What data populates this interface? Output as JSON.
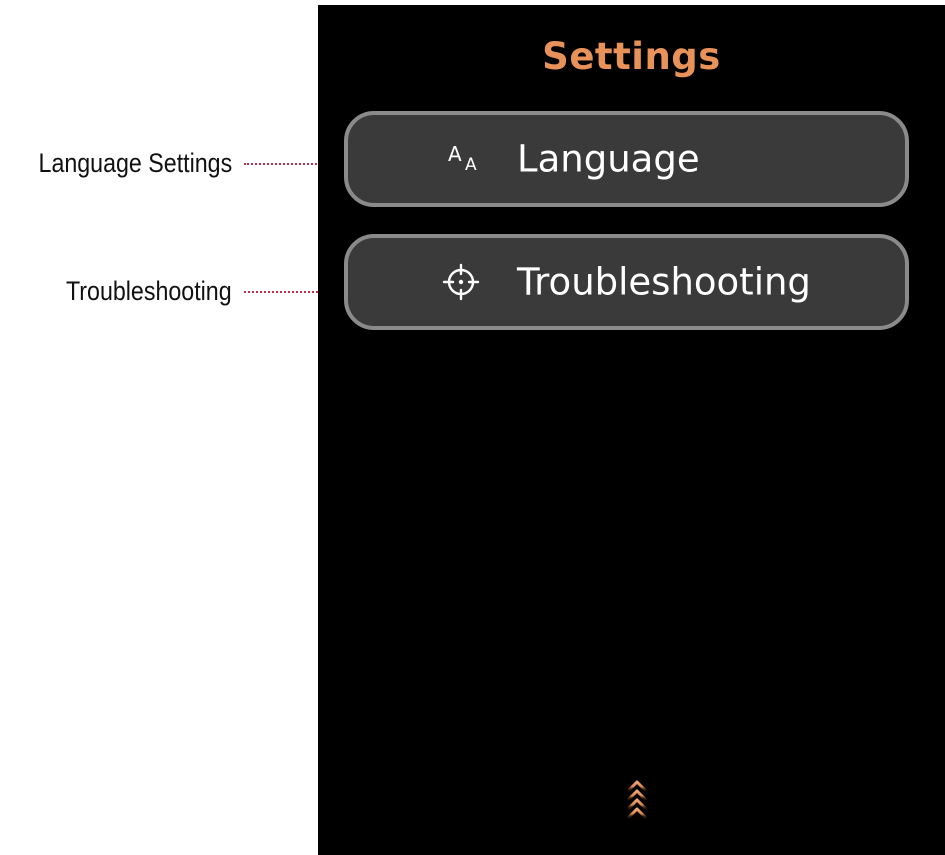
{
  "annotations": {
    "language": "Language Settings",
    "troubleshooting": "Troubleshooting"
  },
  "screen": {
    "title": "Settings",
    "menu": [
      {
        "label": "Language",
        "icon": "font-size-icon"
      },
      {
        "label": "Troubleshooting",
        "icon": "crosshair-icon"
      }
    ],
    "scroll_indicator_icon": "chevrons-up-icon"
  },
  "colors": {
    "title": "#e8925a",
    "screen_background": "#000000",
    "button_fill": "#3a3a3a",
    "button_border": "#8a8a8a",
    "callout_line": "#c0304a"
  }
}
